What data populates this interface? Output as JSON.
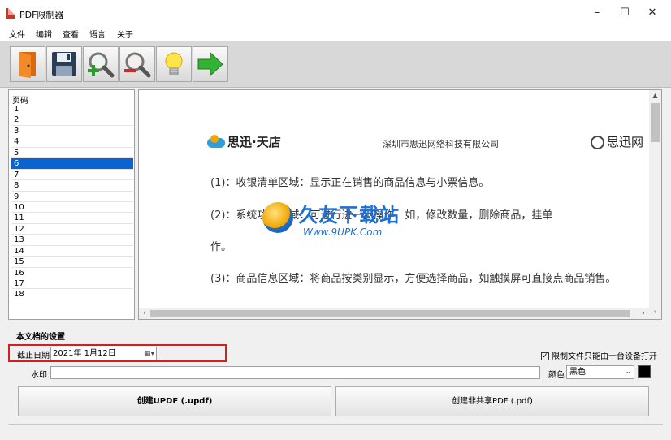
{
  "window": {
    "title": "PDF限制器",
    "min_glyph": "–",
    "max_glyph": "☐",
    "close_glyph": "✕"
  },
  "menu": [
    "文件",
    "编辑",
    "查看",
    "语言",
    "关于"
  ],
  "toolbar": {
    "icons": [
      "open-icon",
      "save-icon",
      "zoom-in-icon",
      "zoom-out-icon",
      "lightbulb-icon",
      "arrow-right-icon"
    ]
  },
  "pages": {
    "header": "页码",
    "items": [
      "1",
      "2",
      "3",
      "4",
      "5",
      "6",
      "7",
      "8",
      "9",
      "10",
      "11",
      "12",
      "13",
      "14",
      "15",
      "16",
      "17",
      "18"
    ],
    "selected": "6"
  },
  "document": {
    "logo_left": "思迅·天店",
    "company": "深圳市思迅网络科技有限公司",
    "logo_right": "思迅网",
    "line1": "(1)：收银清单区域：显示正在销售的商品信息与小票信息。",
    "line2": "(2)：系统功能区域：可进行进一步操作，如，修改数量，删除商品，挂单",
    "line2b": "作。",
    "line3": "(3)：商品信息区域：将商品按类别显示，方便选择商品，如触摸屏可直接点商品销售。",
    "watermark_text": "久友下载站",
    "watermark_url": "Www.9UPK.Com"
  },
  "settings": {
    "title": "本文档的设置",
    "expiry_label": "截止日期",
    "expiry_value": "2021年  1月12日",
    "single_device_label": "限制文件只能由一台设备打开",
    "single_device_checked": true,
    "watermark_label": "水印",
    "watermark_value": "",
    "color_label": "颜色",
    "color_value": "黑色",
    "color_hex": "#000000"
  },
  "buttons": {
    "create_updf": "创建UPDF (.updf)",
    "create_pdf": "创建非共享PDF (.pdf)"
  }
}
